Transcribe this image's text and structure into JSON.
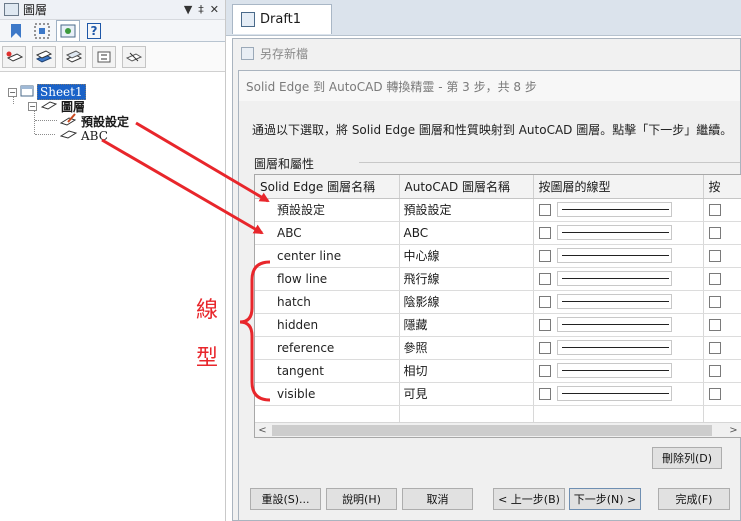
{
  "layer_panel": {
    "title": "圖層",
    "title_tools": [
      "▼",
      "‡",
      "✕"
    ],
    "tabs": [
      {
        "icon": "bookmark-icon"
      },
      {
        "icon": "select-frame-icon"
      },
      {
        "icon": "layers-icon"
      },
      {
        "icon": "help-icon",
        "text": "?"
      }
    ],
    "toolbar": [
      {
        "icon": "new-layer-icon"
      },
      {
        "icon": "activate-layer-icon"
      },
      {
        "icon": "show-layer-icon"
      },
      {
        "icon": "move-layer-icon"
      },
      {
        "icon": "hide-layer-icon"
      }
    ],
    "tree": {
      "sheet": "Sheet1",
      "layers_folder": "圖層",
      "layers": [
        "預設設定",
        "ABC"
      ]
    }
  },
  "doc_tab": {
    "label": "Draft1"
  },
  "save_dialog": {
    "title": "另存新檔"
  },
  "wizard": {
    "title": "Solid Edge 到 AutoCAD 轉換精靈 - 第 3 步，共 8 步",
    "instructions": "通過以下選取，將 Solid Edge 圖層和性質映射到 AutoCAD 圖層。點擊「下一步」繼續。",
    "group_label": "圖層和屬性",
    "columns": [
      "Solid Edge 圖層名稱",
      "AutoCAD 圖層名稱",
      "按圖層的線型",
      "按"
    ],
    "rows": [
      {
        "se": "預設設定",
        "acad": "預設設定"
      },
      {
        "se": "ABC",
        "acad": "ABC"
      },
      {
        "se": "center line",
        "acad": "中心線"
      },
      {
        "se": "flow line",
        "acad": "飛行線"
      },
      {
        "se": "hatch",
        "acad": "陰影線"
      },
      {
        "se": "hidden",
        "acad": "隱藏"
      },
      {
        "se": "reference",
        "acad": "參照"
      },
      {
        "se": "tangent",
        "acad": "相切"
      },
      {
        "se": "visible",
        "acad": "可見"
      }
    ],
    "scroll_arrows": [
      "<",
      ">"
    ],
    "delete_row_button": "刪除列(D)",
    "buttons": {
      "reset": "重設(S)...",
      "help": "說明(H)",
      "cancel": "取消",
      "back": "< 上一步(B)",
      "next": "下一步(N) >",
      "finish": "完成(F)"
    }
  },
  "annotation": {
    "chars": [
      "線",
      "型"
    ],
    "color": "#e8262b"
  }
}
